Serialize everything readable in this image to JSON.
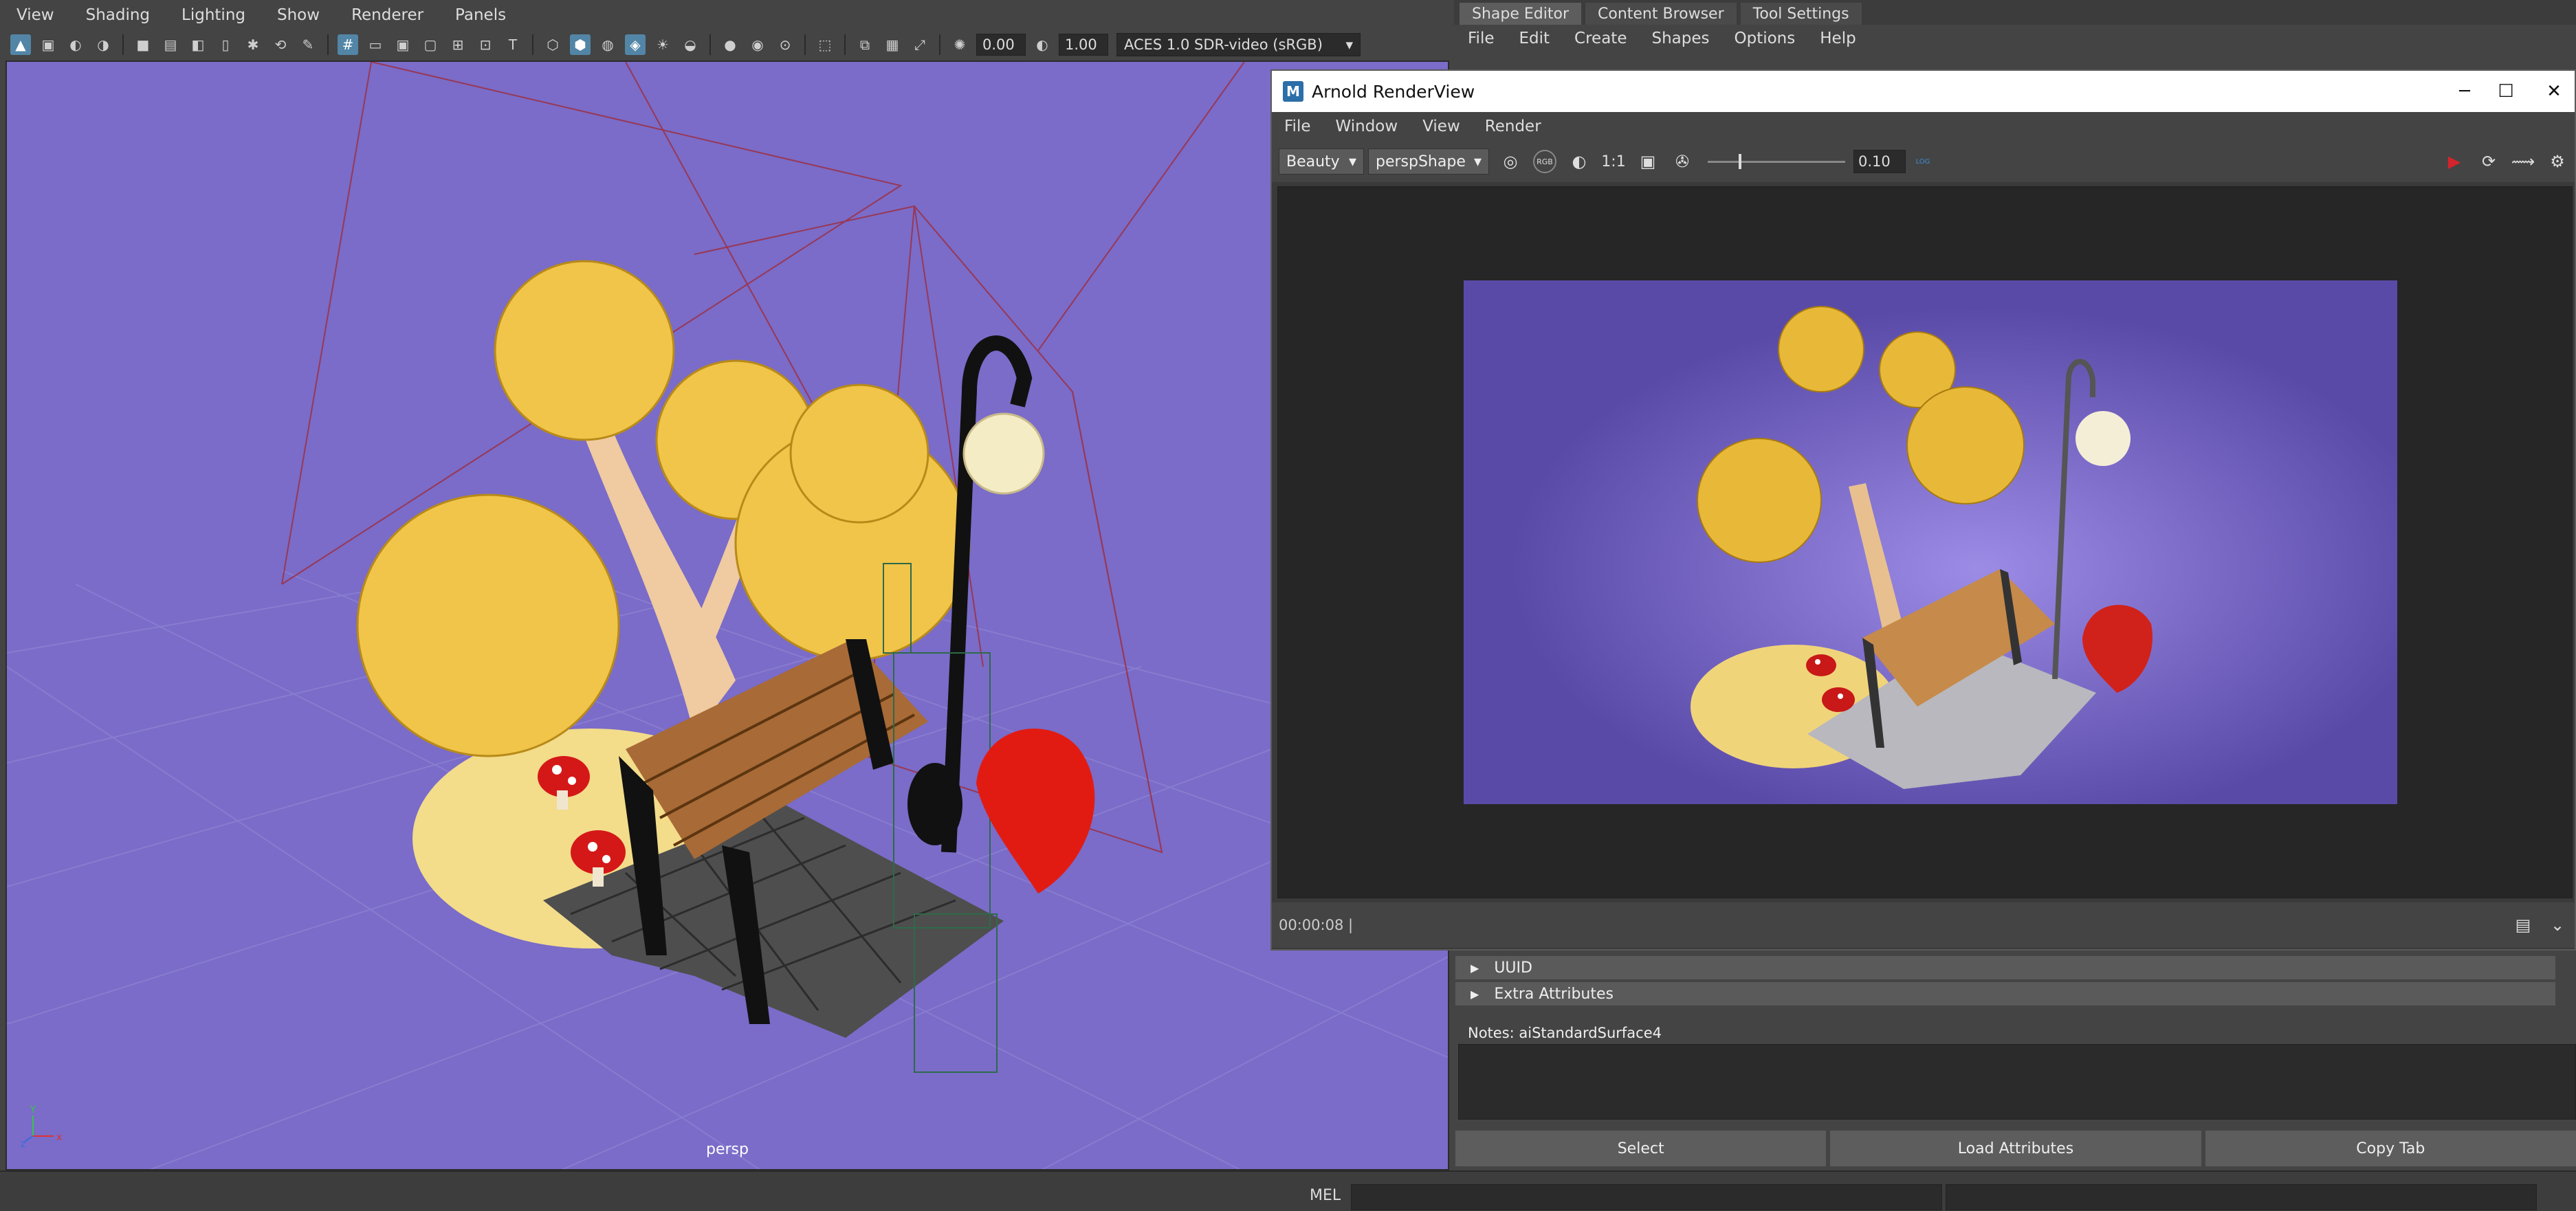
{
  "viewport": {
    "menu": [
      "View",
      "Shading",
      "Lighting",
      "Show",
      "Renderer",
      "Panels"
    ],
    "toolbar": {
      "exposure_value": "0.00",
      "gamma_value": "1.00",
      "color_space": "ACES 1.0 SDR-video (sRGB)"
    },
    "camera_label": "persp",
    "axis_labels": {
      "y": "Y",
      "z": "z",
      "x": "x"
    }
  },
  "right_tabs": [
    "Shape Editor",
    "Content Browser",
    "Tool Settings"
  ],
  "attribute_editor": {
    "menu": [
      "File",
      "Edit",
      "Create",
      "Shapes",
      "Options",
      "Help"
    ],
    "sections": [
      "UUID",
      "Extra Attributes"
    ],
    "notes_label": "Notes:  aiStandardSurface4",
    "buttons": [
      "Select",
      "Load Attributes",
      "Copy Tab"
    ]
  },
  "renderview": {
    "title": "Arnold RenderView",
    "logo_letter": "M",
    "window_controls": {
      "minimize": "─",
      "maximize": "☐",
      "close": "✕"
    },
    "menu": [
      "File",
      "Window",
      "View",
      "Render"
    ],
    "aov": "Beauty",
    "camera": "perspShape",
    "ratio_label": "1:1",
    "rgb_label": "RGB",
    "exposure": "0.10",
    "exposure_fraction": 0.23,
    "log_label": "LOG",
    "render_time": "00:00:08 |"
  },
  "command_line": {
    "label": "MEL"
  },
  "colors": {
    "viewport_bg": "#7a6cc8",
    "render_bg": "#5a4aa8",
    "leaf_yellow": "#f0c54a",
    "umbrella_red": "#e21b12",
    "accent_blue": "#5285a6",
    "render_button_red": "#d4242c"
  }
}
